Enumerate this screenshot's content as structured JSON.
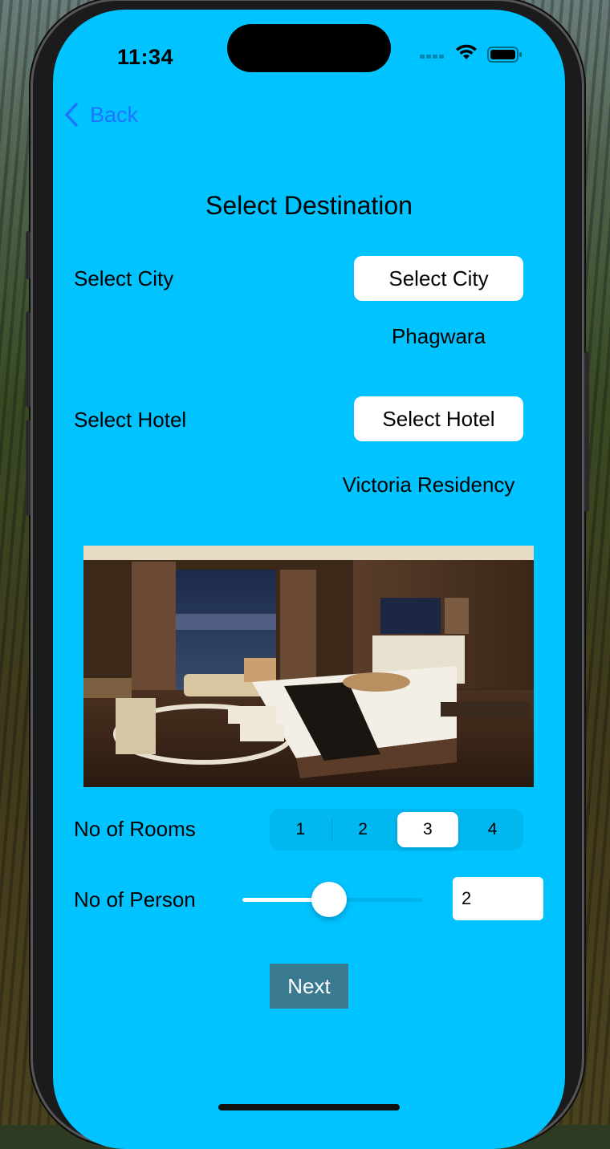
{
  "status": {
    "time": "11:34"
  },
  "nav": {
    "back_label": "Back"
  },
  "page": {
    "title": "Select Destination"
  },
  "city": {
    "label": "Select City",
    "button_label": "Select City",
    "selected_value": "Phagwara"
  },
  "hotel": {
    "label": "Select Hotel",
    "button_label": "Select Hotel",
    "selected_value": "Victoria Residency"
  },
  "rooms": {
    "label": "No of Rooms",
    "options": [
      "1",
      "2",
      "3",
      "4"
    ],
    "selected_index": 2
  },
  "persons": {
    "label": "No of Person",
    "slider_fraction": 0.48,
    "value": "2"
  },
  "actions": {
    "next_label": "Next"
  },
  "colors": {
    "screen_bg": "#00c3ff",
    "accent": "#1d74ff",
    "next_button": "#3a7a90"
  }
}
